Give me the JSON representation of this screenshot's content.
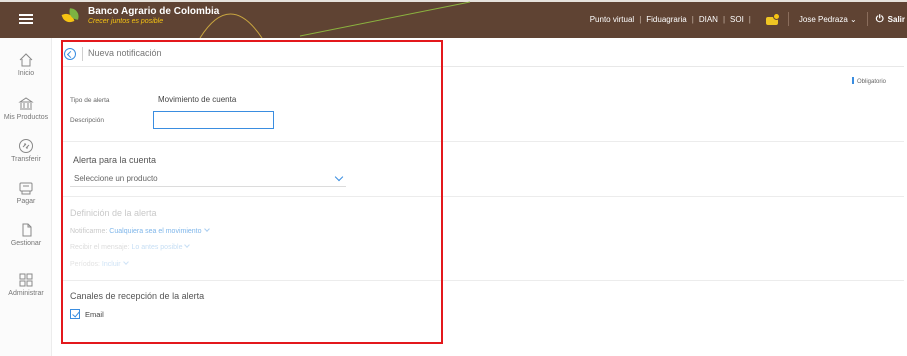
{
  "brand": {
    "title": "Banco Agrario de Colombia",
    "tagline": "Crecer juntos es posible"
  },
  "topnav": {
    "links": [
      "Punto virtual",
      "Fiduagraria",
      "DIAN",
      "SOI"
    ],
    "user": "Jose Pedraza",
    "logout": "Salir"
  },
  "sidebar": {
    "items": [
      {
        "label": "Inicio",
        "icon": "home-icon"
      },
      {
        "label": "Mis Productos",
        "icon": "bank-icon"
      },
      {
        "label": "Transferir",
        "icon": "transfer-icon"
      },
      {
        "label": "Pagar",
        "icon": "payment-icon"
      },
      {
        "label": "Gestionar",
        "icon": "document-icon"
      },
      {
        "label": "Administrar",
        "icon": "grid-icon"
      }
    ]
  },
  "header": {
    "title": "Nueva notificación"
  },
  "required_note": "Obligatorio",
  "form": {
    "alert_type_label": "Tipo de alerta",
    "alert_type_value": "Movimiento de cuenta",
    "description_label": "Descripción",
    "description_value": ""
  },
  "account_section": {
    "title": "Alerta para la cuenta",
    "select_placeholder": "Seleccione un producto"
  },
  "definition_section": {
    "title": "Definición de la alerta",
    "notify_label": "Notificarme:",
    "notify_value": "Cualquiera sea el movimiento",
    "receive_label": "Recibir el mensaje:",
    "receive_value": "Lo antes posible",
    "periods_label": "Períodos:",
    "periods_value": "Incluir"
  },
  "channels_section": {
    "title": "Canales de recepción de la alerta",
    "email_label": "Email",
    "email_checked": true
  },
  "colors": {
    "topbar": "#5f4333",
    "accent": "#3a8de0",
    "highlight": "#e3181c",
    "brand_yellow": "#f6c412"
  }
}
